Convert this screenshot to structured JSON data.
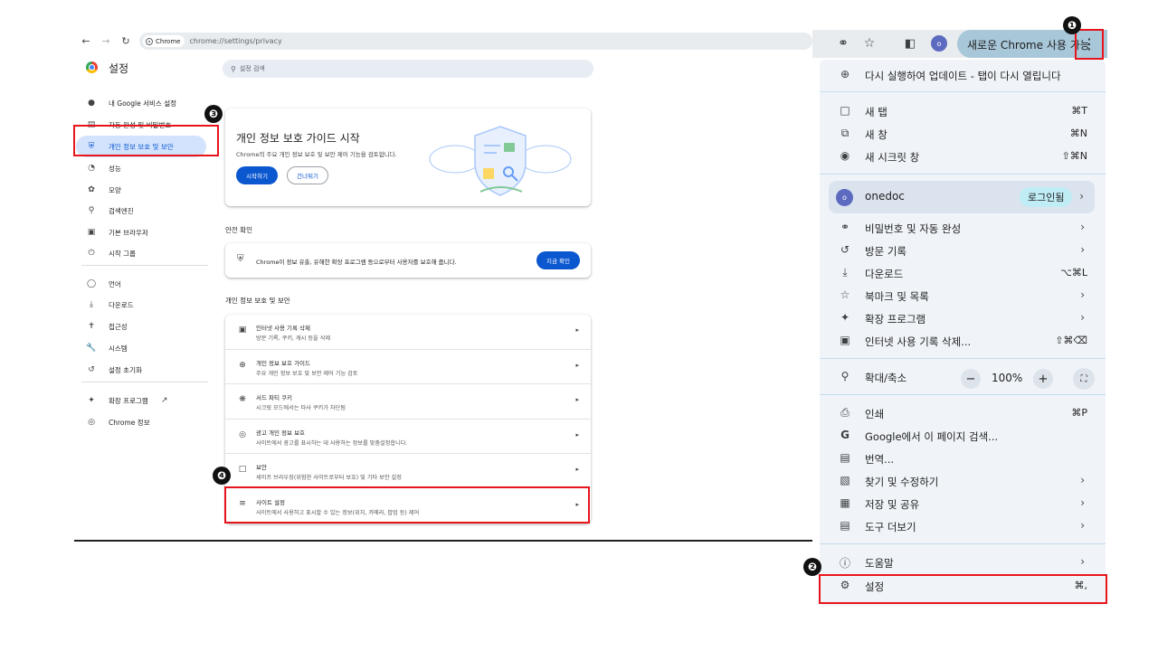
{
  "browser": {
    "chip_label": "Chrome",
    "url": "chrome://settings/privacy",
    "settings_title": "설정",
    "search_placeholder": "설정 검색"
  },
  "sidebar": {
    "items": [
      {
        "icon": "person-icon",
        "label": "내 Google 서비스 설정"
      },
      {
        "icon": "clipboard-icon",
        "label": "자동 완성 및 비밀번호"
      },
      {
        "icon": "shield-icon",
        "label": "개인 정보 보호 및 보안"
      },
      {
        "icon": "speedometer-icon",
        "label": "성능"
      },
      {
        "icon": "palette-icon",
        "label": "모양"
      },
      {
        "icon": "search-icon",
        "label": "검색엔진"
      },
      {
        "icon": "browser-icon",
        "label": "기본 브라우저"
      },
      {
        "icon": "power-icon",
        "label": "시작 그룹"
      },
      {
        "icon": "globe-icon",
        "label": "언어"
      },
      {
        "icon": "download-icon",
        "label": "다운로드"
      },
      {
        "icon": "accessibility-icon",
        "label": "접근성"
      },
      {
        "icon": "wrench-icon",
        "label": "시스템"
      },
      {
        "icon": "history-icon",
        "label": "설정 초기화"
      },
      {
        "icon": "puzzle-icon",
        "label": "확장 프로그램"
      },
      {
        "icon": "chrome-icon",
        "label": "Chrome 정보"
      }
    ]
  },
  "guide": {
    "title": "개인 정보 보호 가이드 시작",
    "desc": "Chrome의 주요 개인 정보 보호 및 보안 제어 기능을 검토합니다.",
    "start_button": "시작하기",
    "skip_button": "건너뛰기"
  },
  "safety": {
    "section_label": "안전 확인",
    "text": "Chrome이 정보 유출, 유해한 확장 프로그램 등으로부터 사용자를 보호해 줍니다.",
    "button": "지금 확인"
  },
  "privacy": {
    "section_label": "개인 정보 보호 및 보안",
    "rows": [
      {
        "icon": "trash-icon",
        "title": "인터넷 사용 기록 삭제",
        "desc": "방문 기록, 쿠키, 캐시 등을 삭제"
      },
      {
        "icon": "add-circle-icon",
        "title": "개인 정보 보호 가이드",
        "desc": "주요 개인 정보 보호 및 보안 제어 기능 검토"
      },
      {
        "icon": "cookie-icon",
        "title": "서드 파티 쿠키",
        "desc": "시크릿 모드에서는 타사 쿠키가 차단됨"
      },
      {
        "icon": "ad-privacy-icon",
        "title": "광고 개인 정보 보호",
        "desc": "사이트에서 광고를 표시하는 데 사용하는 정보를 맞춤설정합니다."
      },
      {
        "icon": "lock-icon",
        "title": "보안",
        "desc": "세이프 브라우징(위험한 사이트로부터 보호) 및 기타 보안 설정"
      },
      {
        "icon": "tune-icon",
        "title": "사이트 설정",
        "desc": "사이트에서 사용하고 표시할 수 있는 정보(위치, 카메라, 팝업 등) 제어"
      }
    ]
  },
  "toolbar": {
    "profile_initial": "o",
    "update_label": "새로운 Chrome 사용 가능"
  },
  "menu": {
    "update": {
      "icon": "update-icon",
      "label": "다시 실행하여 업데이트 - 탭이 다시 열립니다"
    },
    "new_tab": {
      "icon": "new-tab-icon",
      "label": "새 탭",
      "shortcut": "⌘T"
    },
    "new_window": {
      "icon": "new-window-icon",
      "label": "새 창",
      "shortcut": "⌘N"
    },
    "incognito": {
      "icon": "incognito-icon",
      "label": "새 시크릿 창",
      "shortcut": "⇧⌘N"
    },
    "profile": {
      "initial": "o",
      "name": "onedoc",
      "badge": "로그인됨"
    },
    "passwords": {
      "icon": "key-icon",
      "label": "비밀번호 및 자동 완성"
    },
    "history": {
      "icon": "history-icon",
      "label": "방문 기록"
    },
    "downloads": {
      "icon": "download-icon",
      "label": "다운로드",
      "shortcut": "⌥⌘L"
    },
    "bookmarks": {
      "icon": "star-icon",
      "label": "북마크 및 목록"
    },
    "extensions": {
      "icon": "puzzle-icon",
      "label": "확장 프로그램"
    },
    "clear_data": {
      "icon": "trash-icon",
      "label": "인터넷 사용 기록 삭제...",
      "shortcut": "⇧⌘⌫"
    },
    "zoom": {
      "icon": "zoom-icon",
      "label": "확대/축소",
      "value": "100%",
      "minus": "−",
      "plus": "+"
    },
    "print": {
      "icon": "print-icon",
      "label": "인쇄",
      "shortcut": "⌘P"
    },
    "search_page": {
      "icon": "google-icon",
      "label": "Google에서 이 페이지 검색..."
    },
    "translate": {
      "icon": "translate-icon",
      "label": "번역..."
    },
    "find_edit": {
      "icon": "find-icon",
      "label": "찾기 및 수정하기"
    },
    "save_share": {
      "icon": "save-share-icon",
      "label": "저장 및 공유"
    },
    "more_tools": {
      "icon": "toolbox-icon",
      "label": "도구 더보기"
    },
    "help": {
      "icon": "help-icon",
      "label": "도움말"
    },
    "settings": {
      "icon": "gear-icon",
      "label": "설정",
      "shortcut": "⌘,"
    }
  },
  "annotations": {
    "step1": "❶",
    "step2": "❷",
    "step3": "❸",
    "step4": "❹",
    "highlight_color": "#e8141c"
  }
}
